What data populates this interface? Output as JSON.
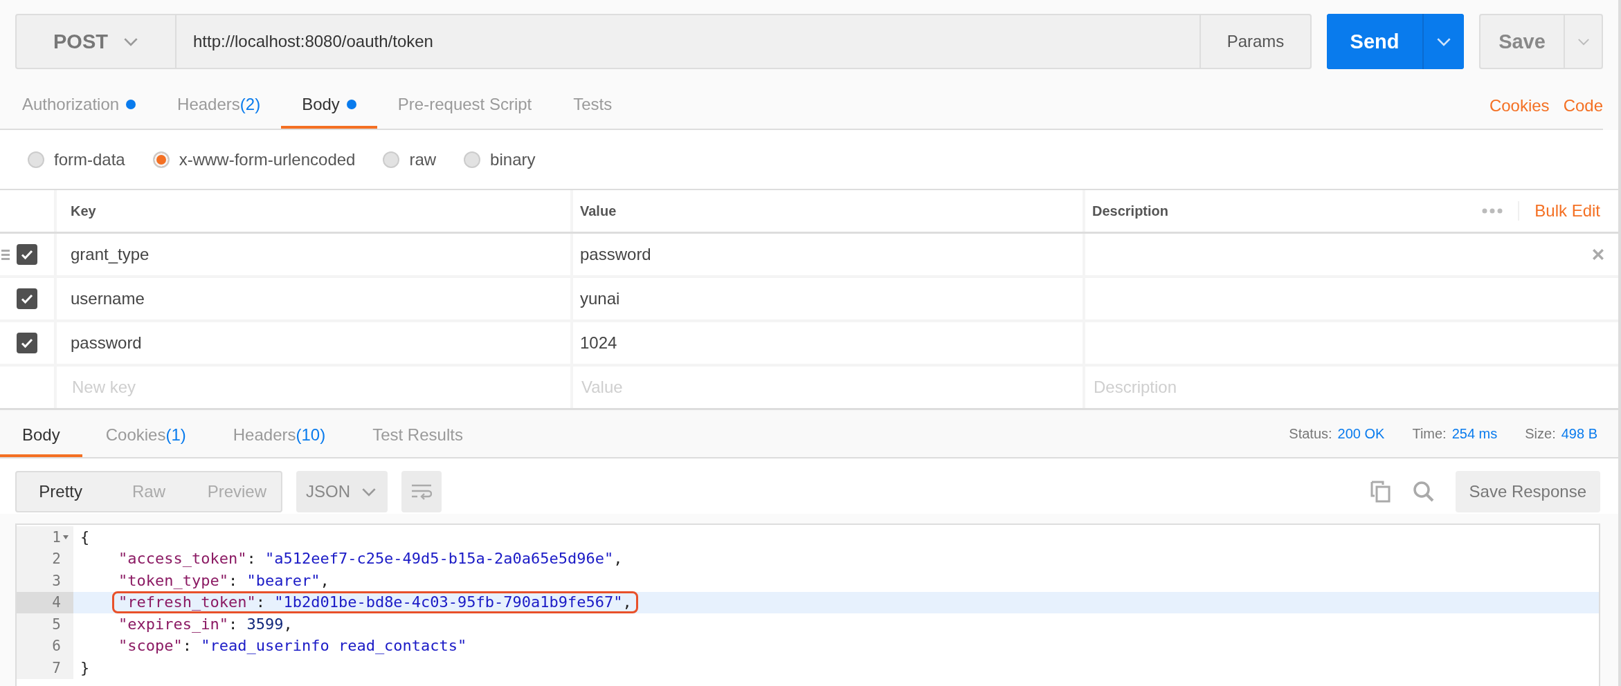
{
  "request": {
    "method": "POST",
    "url": "http://localhost:8080/oauth/token",
    "params_button": "Params",
    "send_button": "Send",
    "save_button": "Save"
  },
  "request_tabs": [
    {
      "label": "Authorization",
      "dot": true,
      "selected": false
    },
    {
      "label": "Headers",
      "count": "(2)",
      "dot": false,
      "selected": false
    },
    {
      "label": "Body",
      "dot": true,
      "selected": true
    },
    {
      "label": "Pre-request Script",
      "dot": false,
      "selected": false
    },
    {
      "label": "Tests",
      "dot": false,
      "selected": false
    }
  ],
  "request_links": [
    "Cookies",
    "Code"
  ],
  "body_modes": [
    {
      "label": "form-data",
      "selected": false
    },
    {
      "label": "x-www-form-urlencoded",
      "selected": true
    },
    {
      "label": "raw",
      "selected": false
    },
    {
      "label": "binary",
      "selected": false
    }
  ],
  "params_table": {
    "columns": [
      "Key",
      "Value",
      "Description"
    ],
    "bulk_edit": "Bulk Edit",
    "rows": [
      {
        "key": "grant_type",
        "value": "password",
        "checked": true
      },
      {
        "key": "username",
        "value": "yunai",
        "checked": true
      },
      {
        "key": "password",
        "value": "1024",
        "checked": true
      }
    ],
    "new_row": {
      "key_placeholder": "New key",
      "value_placeholder": "Value",
      "description_placeholder": "Description"
    }
  },
  "response_tabs": [
    {
      "label": "Body",
      "selected": true
    },
    {
      "label": "Cookies",
      "count": "(1)",
      "selected": false
    },
    {
      "label": "Headers",
      "count": "(10)",
      "selected": false
    },
    {
      "label": "Test Results",
      "selected": false
    }
  ],
  "response_status": [
    {
      "label": "Status:",
      "value": "200 OK"
    },
    {
      "label": "Time:",
      "value": "254 ms"
    },
    {
      "label": "Size:",
      "value": "498 B"
    }
  ],
  "view_modes": [
    {
      "label": "Pretty",
      "selected": true
    },
    {
      "label": "Raw",
      "selected": false
    },
    {
      "label": "Preview",
      "selected": false
    }
  ],
  "format": "JSON",
  "save_response": "Save Response",
  "code_lines": [
    {
      "number": "1",
      "foldable": true,
      "current": false,
      "annotated": false,
      "tokens": [
        {
          "kind": "punct",
          "text": "{"
        }
      ],
      "children": [
        {
          "number": "2",
          "foldable": false,
          "current": false,
          "annotated": false,
          "tokens": [
            {
              "kind": "key",
              "text": "\"access_token\""
            },
            {
              "kind": "punct",
              "text": ": "
            },
            {
              "kind": "string",
              "text": "\"a512eef7-c25e-49d5-b15a-2a0a65e5d96e\""
            },
            {
              "kind": "punct",
              "text": ","
            }
          ]
        },
        {
          "number": "3",
          "foldable": false,
          "current": false,
          "annotated": false,
          "tokens": [
            {
              "kind": "key",
              "text": "\"token_type\""
            },
            {
              "kind": "punct",
              "text": ": "
            },
            {
              "kind": "string",
              "text": "\"bearer\""
            },
            {
              "kind": "punct",
              "text": ","
            }
          ]
        },
        {
          "number": "4",
          "foldable": false,
          "current": true,
          "annotated": true,
          "tokens": [
            {
              "kind": "key",
              "text": "\"refresh_token\""
            },
            {
              "kind": "punct",
              "text": ": "
            },
            {
              "kind": "string",
              "text": "\"1b2d01be-bd8e-4c03-95fb-790a1b9fe567\""
            },
            {
              "kind": "punct",
              "text": ","
            }
          ]
        },
        {
          "number": "5",
          "foldable": false,
          "current": false,
          "annotated": false,
          "tokens": [
            {
              "kind": "key",
              "text": "\"expires_in\""
            },
            {
              "kind": "punct",
              "text": ": "
            },
            {
              "kind": "number",
              "text": "3599"
            },
            {
              "kind": "punct",
              "text": ","
            }
          ]
        },
        {
          "number": "6",
          "foldable": false,
          "current": false,
          "annotated": false,
          "tokens": [
            {
              "kind": "key",
              "text": "\"scope\""
            },
            {
              "kind": "punct",
              "text": ": "
            },
            {
              "kind": "string",
              "text": "\"read_userinfo read_contacts\""
            }
          ]
        }
      ]
    },
    {
      "number": "7",
      "foldable": false,
      "current": false,
      "annotated": false,
      "tokens": [
        {
          "kind": "punct",
          "text": "}"
        }
      ]
    }
  ]
}
